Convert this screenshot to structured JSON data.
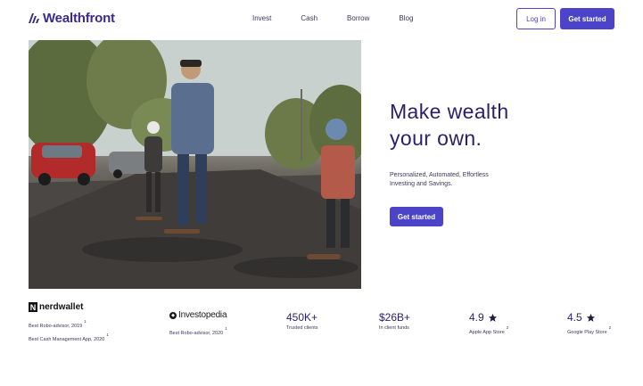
{
  "brand": {
    "name": "Wealthfront",
    "color": "#3b2a8c"
  },
  "nav": {
    "items": [
      "Invest",
      "Cash",
      "Borrow",
      "Blog"
    ]
  },
  "header": {
    "login_label": "Log in",
    "start_label": "Get started"
  },
  "hero": {
    "headline_line1": "Make wealth",
    "headline_line2": "your own.",
    "sub_line1": "Personalized, Automated, Effortless",
    "sub_line2": "Investing and Savings.",
    "cta_label": "Get started"
  },
  "awards": {
    "nerdwallet": {
      "logo_text": "nerdwallet",
      "line1": "Best Robo-advisor, 2019",
      "line1_sup": "1",
      "line2": "Best Cash Management App, 2020",
      "line2_sup": "1"
    },
    "investopedia": {
      "logo_text": "Investopedia",
      "line1": "Best Robo-advisor, 2020",
      "line1_sup": "1"
    }
  },
  "stats": [
    {
      "value": "450K+",
      "label": "Trusted clients"
    },
    {
      "value": "$26B+",
      "label": "In client funds"
    },
    {
      "value": "4.9",
      "label": "Apple App Store",
      "sup": "2"
    },
    {
      "value": "4.5",
      "label": "Google Play Store",
      "sup": "2"
    }
  ],
  "colors": {
    "accent": "#4b44c8",
    "text": "#2a1f6b"
  }
}
